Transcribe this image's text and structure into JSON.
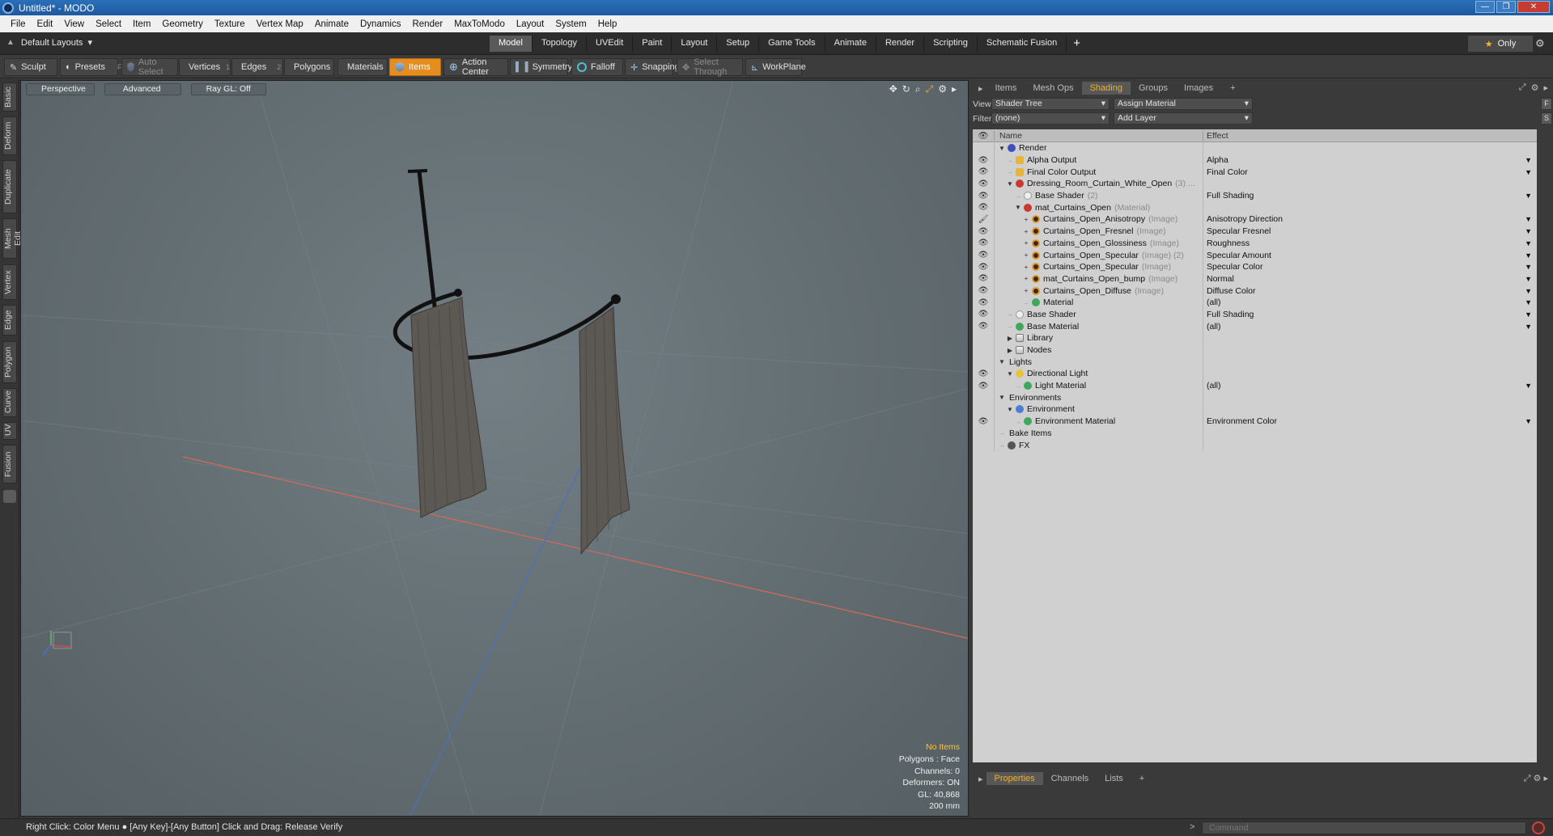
{
  "window": {
    "title": "Untitled* - MODO"
  },
  "menu": [
    "File",
    "Edit",
    "View",
    "Select",
    "Item",
    "Geometry",
    "Texture",
    "Vertex Map",
    "Animate",
    "Dynamics",
    "Render",
    "MaxToModo",
    "Layout",
    "System",
    "Help"
  ],
  "layoutbar": {
    "layout_name": "Default Layouts",
    "tabs": [
      "Model",
      "Topology",
      "UVEdit",
      "Paint",
      "Layout",
      "Setup",
      "Game Tools",
      "Animate",
      "Render",
      "Scripting",
      "Schematic Fusion"
    ],
    "active_tab": "Model",
    "plus": "+",
    "only_label": "Only"
  },
  "toolbar": {
    "sculpt": "Sculpt",
    "presets": "Presets",
    "presets_key": "F6",
    "auto_select": "Auto Select",
    "vertices": "Vertices",
    "vertices_key": "1",
    "edges": "Edges",
    "edges_key": "2",
    "polygons": "Polygons",
    "materials": "Materials",
    "items": "Items",
    "action_center": "Action Center",
    "symmetry": "Symmetry",
    "falloff": "Falloff",
    "snapping": "Snapping",
    "select_through": "Select Through",
    "workplane": "WorkPlane"
  },
  "leftbar": [
    "Basic",
    "Deform",
    "Duplicate",
    "Mesh Edit",
    "Vertex",
    "Edge",
    "Polygon",
    "Curve",
    "UV",
    "Fusion"
  ],
  "viewport": {
    "view": "Perspective",
    "shading": "Advanced",
    "raygl": "Ray GL: Off",
    "info": {
      "no_items": "No Items",
      "polygons": "Polygons : Face",
      "channels": "Channels: 0",
      "deformers": "Deformers: ON",
      "gl": "GL: 40,868",
      "size": "200 mm"
    }
  },
  "rightpanel": {
    "tabs": [
      "Items",
      "Mesh Ops",
      "Shading",
      "Groups",
      "Images"
    ],
    "active_tab": "Shading",
    "view_label": "View",
    "view_value": "Shader Tree",
    "assign_material": "Assign Material",
    "filter_label": "Filter",
    "filter_value": "(none)",
    "add_layer": "Add Layer",
    "f_btn": "F",
    "s_btn": "S",
    "col_name": "Name",
    "col_effect": "Effect",
    "rows": [
      {
        "indent": 0,
        "arrow": "▼",
        "icon": "render",
        "name": "Render",
        "sub": "",
        "effect": "",
        "eye": false
      },
      {
        "indent": 1,
        "arrow": "",
        "icon": "output",
        "name": "Alpha Output",
        "sub": "",
        "effect": "Alpha",
        "eye": true
      },
      {
        "indent": 1,
        "arrow": "",
        "icon": "output",
        "name": "Final Color Output",
        "sub": "",
        "effect": "Final Color",
        "eye": true
      },
      {
        "indent": 1,
        "arrow": "▼",
        "icon": "mask",
        "name": "Dressing_Room_Curtain_White_Open",
        "sub": "(3) ...",
        "effect": "",
        "eye": true
      },
      {
        "indent": 2,
        "arrow": "",
        "icon": "shader",
        "name": "Base Shader",
        "sub": "(2)",
        "effect": "Full Shading",
        "eye": true
      },
      {
        "indent": 2,
        "arrow": "▼",
        "icon": "mask",
        "name": "mat_Curtains_Open",
        "sub": "(Material)",
        "effect": "",
        "eye": true
      },
      {
        "indent": 3,
        "arrow": "+",
        "icon": "image",
        "name": "Curtains_Open_Anisotropy",
        "sub": "(Image)",
        "effect": "Anisotropy Direction",
        "eye": true,
        "brush": true
      },
      {
        "indent": 3,
        "arrow": "+",
        "icon": "image",
        "name": "Curtains_Open_Fresnel",
        "sub": "(Image)",
        "effect": "Specular Fresnel",
        "eye": true
      },
      {
        "indent": 3,
        "arrow": "+",
        "icon": "image",
        "name": "Curtains_Open_Glossiness",
        "sub": "(Image)",
        "effect": "Roughness",
        "eye": true
      },
      {
        "indent": 3,
        "arrow": "+",
        "icon": "image",
        "name": "Curtains_Open_Specular",
        "sub": "(Image) (2)",
        "effect": "Specular Amount",
        "eye": true
      },
      {
        "indent": 3,
        "arrow": "+",
        "icon": "image",
        "name": "Curtains_Open_Specular",
        "sub": "(Image)",
        "effect": "Specular Color",
        "eye": true
      },
      {
        "indent": 3,
        "arrow": "+",
        "icon": "image",
        "name": "mat_Curtains_Open_bump",
        "sub": "(Image)",
        "effect": "Normal",
        "eye": true
      },
      {
        "indent": 3,
        "arrow": "+",
        "icon": "image",
        "name": "Curtains_Open_Diffuse",
        "sub": "(Image)",
        "effect": "Diffuse Color",
        "eye": true
      },
      {
        "indent": 3,
        "arrow": "",
        "icon": "material",
        "name": "Material",
        "sub": "",
        "effect": "(all)",
        "eye": true
      },
      {
        "indent": 1,
        "arrow": "",
        "icon": "shader",
        "name": "Base Shader",
        "sub": "",
        "effect": "Full Shading",
        "eye": true
      },
      {
        "indent": 1,
        "arrow": "",
        "icon": "material",
        "name": "Base Material",
        "sub": "",
        "effect": "(all)",
        "eye": true
      },
      {
        "indent": 1,
        "arrow": "▶",
        "icon": "folder",
        "name": "Library",
        "sub": "",
        "effect": "",
        "eye": false
      },
      {
        "indent": 1,
        "arrow": "▶",
        "icon": "folder",
        "name": "Nodes",
        "sub": "",
        "effect": "",
        "eye": false
      },
      {
        "indent": 0,
        "arrow": "▼",
        "icon": "none",
        "name": "Lights",
        "sub": "",
        "effect": "",
        "eye": false
      },
      {
        "indent": 1,
        "arrow": "▼",
        "icon": "light",
        "name": "Directional Light",
        "sub": "",
        "effect": "",
        "eye": true
      },
      {
        "indent": 2,
        "arrow": "",
        "icon": "material",
        "name": "Light Material",
        "sub": "",
        "effect": "(all)",
        "eye": true
      },
      {
        "indent": 0,
        "arrow": "▼",
        "icon": "none",
        "name": "Environments",
        "sub": "",
        "effect": "",
        "eye": false
      },
      {
        "indent": 1,
        "arrow": "▼",
        "icon": "env",
        "name": "Environment",
        "sub": "",
        "effect": "",
        "eye": false
      },
      {
        "indent": 2,
        "arrow": "",
        "icon": "material",
        "name": "Environment Material",
        "sub": "",
        "effect": "Environment Color",
        "eye": true
      },
      {
        "indent": 0,
        "arrow": "",
        "icon": "none",
        "name": "Bake Items",
        "sub": "",
        "effect": "",
        "eye": false
      },
      {
        "indent": 0,
        "arrow": "",
        "icon": "fx",
        "name": "FX",
        "sub": "",
        "effect": "",
        "eye": false
      }
    ],
    "props_tabs": [
      "Properties",
      "Channels",
      "Lists"
    ],
    "props_active": "Properties"
  },
  "statusbar": {
    "hint": "Right Click: Color Menu ● [Any Key]-[Any Button] Click and Drag: Release Verify",
    "command_placeholder": "Command",
    "prompt": ">"
  },
  "colors": {
    "accent": "#e58d1f",
    "active_tab_text": "#f1b12c",
    "viewport_bg": "#667176"
  }
}
